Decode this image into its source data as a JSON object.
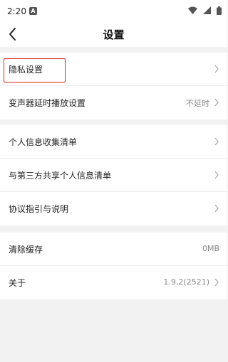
{
  "status_bar": {
    "time": "2:20",
    "notification_icon": "A"
  },
  "header": {
    "title": "设置"
  },
  "group1": [
    {
      "label": "隐私设置",
      "value": ""
    },
    {
      "label": "变声器延时播放设置",
      "value": "不延时"
    }
  ],
  "group2": [
    {
      "label": "个人信息收集清单",
      "value": ""
    },
    {
      "label": "与第三方共享个人信息清单",
      "value": ""
    },
    {
      "label": "协议指引与说明",
      "value": ""
    }
  ],
  "group3": [
    {
      "label": "清除缓存",
      "value": "0MB"
    },
    {
      "label": "关于",
      "value": "1.9.2(2521)"
    }
  ],
  "colors": {
    "highlight_border": "#e0241f",
    "background": "#f2f2f2"
  }
}
